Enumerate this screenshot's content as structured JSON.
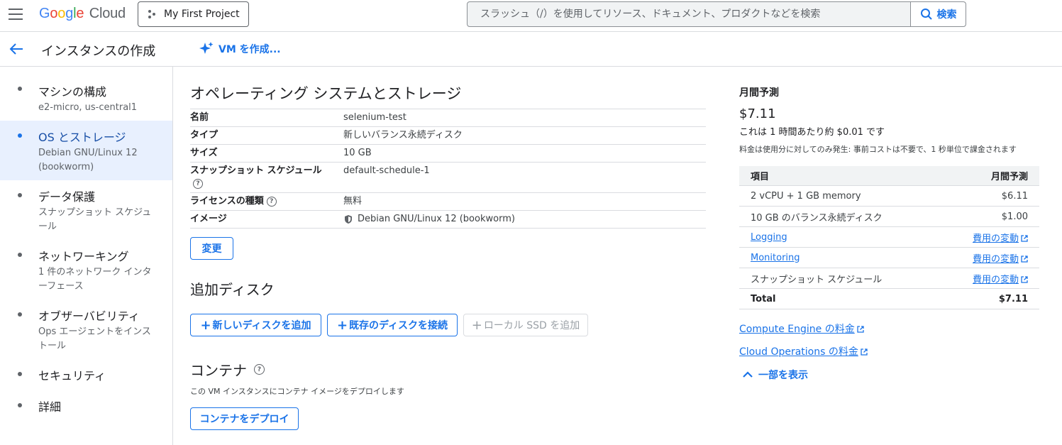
{
  "header": {
    "logo_google": "Google",
    "logo_cloud": "Cloud",
    "project": "My First Project",
    "search_placeholder": "スラッシュ（/）を使用してリソース、ドキュメント、プロダクトなどを検索",
    "search_button": "検索"
  },
  "titlebar": {
    "title": "インスタンスの作成",
    "vm_create": "VM を作成..."
  },
  "sidebar": {
    "items": [
      {
        "label": "マシンの構成",
        "sub": "e2-micro, us-central1"
      },
      {
        "label": "OS とストレージ",
        "sub": "Debian GNU/Linux 12 (bookworm)"
      },
      {
        "label": "データ保護",
        "sub": "スナップショット スケジュール"
      },
      {
        "label": "ネットワーキング",
        "sub": "1 件のネットワーク インターフェース"
      },
      {
        "label": "オブザーバビリティ",
        "sub": "Ops エージェントをインストール"
      },
      {
        "label": "セキュリティ",
        "sub": ""
      },
      {
        "label": "詳細",
        "sub": ""
      }
    ]
  },
  "main": {
    "os_title": "オペレーティング システムとストレージ",
    "spec": [
      {
        "key": "名前",
        "value": "selenium-test"
      },
      {
        "key": "タイプ",
        "value": "新しいバランス永続ディスク"
      },
      {
        "key": "サイズ",
        "value": "10 GB"
      },
      {
        "key": "スナップショット スケジュール",
        "value": "default-schedule-1"
      },
      {
        "key": "ライセンスの種類",
        "value": "無料"
      },
      {
        "key": "イメージ",
        "value": "Debian GNU/Linux 12 (bookworm)"
      }
    ],
    "change_button": "変更",
    "additional_disk_title": "追加ディスク",
    "add_new_disk": "新しいディスクを追加",
    "attach_existing": "既存のディスクを接続",
    "add_local_ssd": "ローカル SSD を追加",
    "container_title": "コンテナ",
    "container_desc": "この VM インスタンスにコンテナ イメージをデプロイします",
    "deploy_container": "コンテナをデプロイ"
  },
  "cost": {
    "title": "月間予測",
    "price": "$7.11",
    "hourly": "これは 1 時間あたり約 $0.01 です",
    "note": "料金は使用分に対してのみ発生: 事前コストは不要で、1 秒単位で課金されます",
    "head_item": "項目",
    "head_value": "月間予測",
    "rows": [
      {
        "item": "2 vCPU + 1 GB memory",
        "value": "$6.11"
      },
      {
        "item": "10 GB のバランス永続ディスク",
        "value": "$1.00"
      },
      {
        "item": "Logging",
        "value": "費用の変動"
      },
      {
        "item": "Monitoring",
        "value": "費用の変動"
      },
      {
        "item": "スナップショット スケジュール",
        "value": "費用の変動"
      }
    ],
    "total_label": "Total",
    "total_value": "$7.11",
    "compute_pricing": "Compute Engine の料金",
    "ops_pricing": "Cloud Operations の料金",
    "show_less": "一部を表示"
  },
  "colors": {
    "accent": "#1a73e8",
    "active_bg": "#e8f0fe"
  }
}
